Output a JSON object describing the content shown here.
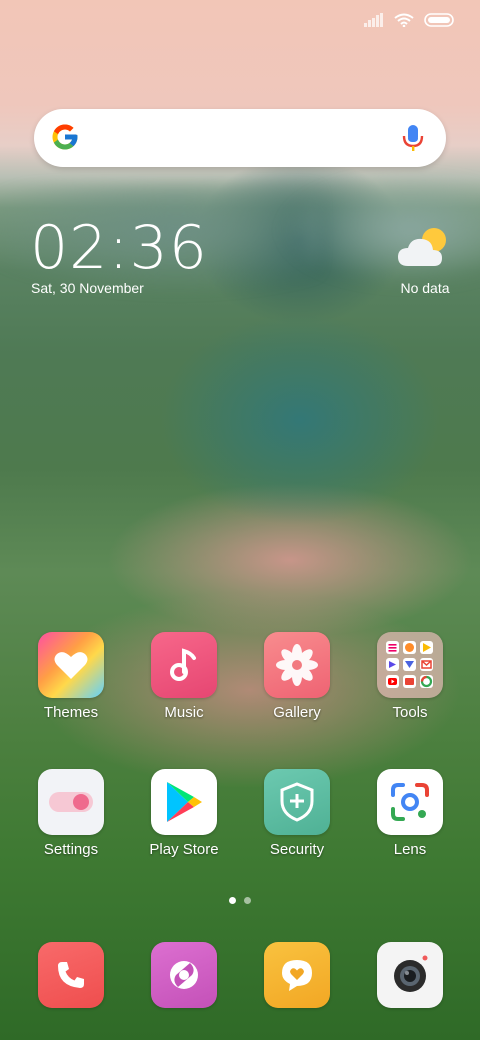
{
  "status_bar": {
    "signal_icon": "signal-icon",
    "wifi_icon": "wifi-icon",
    "battery_icon": "battery-icon"
  },
  "search": {
    "logo": "google-logo",
    "mic_icon": "microphone-icon"
  },
  "clock": {
    "time": "02:36",
    "date": "Sat, 30 November"
  },
  "weather": {
    "icon": "partly-cloudy-icon",
    "label": "No data"
  },
  "apps_row1": [
    {
      "label": "Themes",
      "icon": "themes-icon"
    },
    {
      "label": "Music",
      "icon": "music-icon"
    },
    {
      "label": "Gallery",
      "icon": "gallery-icon"
    },
    {
      "label": "Tools",
      "icon": "tools-folder-icon"
    }
  ],
  "apps_row2": [
    {
      "label": "Settings",
      "icon": "settings-icon"
    },
    {
      "label": "Play Store",
      "icon": "play-store-icon"
    },
    {
      "label": "Security",
      "icon": "security-icon"
    },
    {
      "label": "Lens",
      "icon": "lens-icon"
    }
  ],
  "page_indicator": {
    "pages": 2,
    "active": 1
  },
  "dock": [
    {
      "icon": "phone-icon"
    },
    {
      "icon": "browser-icon"
    },
    {
      "icon": "messaging-icon"
    },
    {
      "icon": "camera-icon"
    }
  ],
  "colors": {
    "themes_gradient": [
      "#ff5fa2",
      "#ffb347",
      "#7be0ff"
    ],
    "music": "#f0557d",
    "gallery": "#f06f7f",
    "security": "#5dbfa6",
    "phone": "#f05a5a",
    "browser": "#d262c6",
    "messaging": "#f6b532"
  }
}
